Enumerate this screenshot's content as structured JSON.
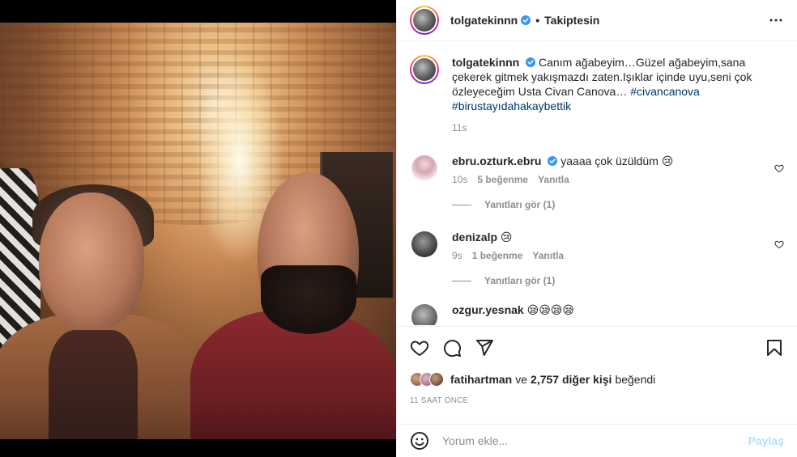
{
  "header": {
    "username": "tolgatekinnn",
    "separator": "•",
    "follow_status": "Takiptesin",
    "more_icon": "more-horizontal-icon"
  },
  "caption": {
    "username": "tolgatekinnn",
    "text": "Canım ağabeyim…Güzel ağabeyim,sana çekerek gitmek yakışmazdı zaten.Işıklar içinde uyu,seni çok özleyeceğim Usta Civan Canova…",
    "tags": [
      "#civancanova",
      "#birustayıdahakaybettik"
    ],
    "time": "11s"
  },
  "comments": [
    {
      "username": "ebru.ozturk.ebru",
      "verified": true,
      "text": "yaaaa çok üzüldüm 😢",
      "time": "10s",
      "likes": "5 beğenme",
      "reply": "Yanıtla",
      "view_replies": "Yanıtları gör (1)"
    },
    {
      "username": "denizalp",
      "verified": false,
      "text": "😢",
      "time": "9s",
      "likes": "1 beğenme",
      "reply": "Yanıtla",
      "view_replies": "Yanıtları gör (1)"
    }
  ],
  "partial_comment": {
    "username": "ozgur.yesnak",
    "text": "😪😪😪😪"
  },
  "likes": {
    "first_liker": "fatihartman",
    "connector": "ve",
    "others": "2,757 diğer kişi",
    "suffix": "beğendi"
  },
  "timestamp": "11 SAAT ÖNCE",
  "composer": {
    "placeholder": "Yorum ekle...",
    "post_label": "Paylaş"
  },
  "colors": {
    "text": "#262626",
    "muted": "#8e8e8e",
    "link": "#00376b",
    "verified": "#3897f0",
    "post_disabled": "#b2dffc"
  }
}
